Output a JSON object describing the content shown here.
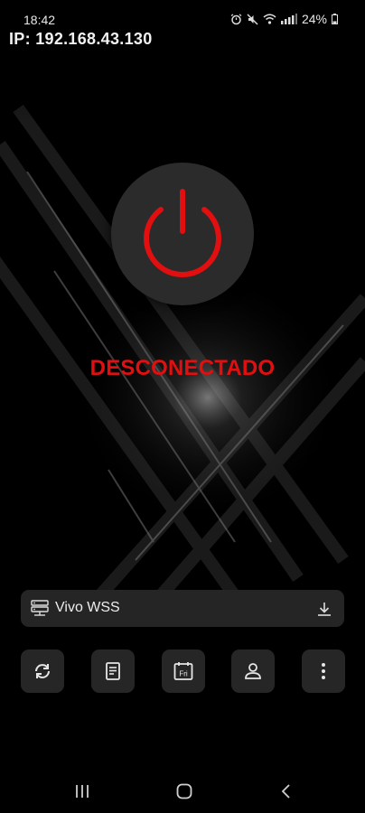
{
  "status_bar": {
    "time": "18:42",
    "battery": "24%",
    "icons": [
      "alarm-icon",
      "mute-icon",
      "wifi-icon",
      "signal-icon",
      "battery-icon"
    ]
  },
  "ip_label": "IP: 192.168.43.130",
  "connection": {
    "status": "DESCONECTADO",
    "status_color": "#e10f0f",
    "power_icon": "power-icon"
  },
  "server": {
    "name": "Vivo WSS",
    "icon": "server-icon",
    "action_icon": "download-icon"
  },
  "toolbar": {
    "buttons": [
      "refresh-icon",
      "document-icon",
      "calendar-icon",
      "user-icon",
      "more-vertical-icon"
    ],
    "calendar_label": "Fri"
  },
  "nav": {
    "buttons": [
      "recent-apps-icon",
      "home-icon",
      "back-icon"
    ]
  },
  "colors": {
    "background": "#000000",
    "accent": "#e10f0f",
    "panel": "#252525"
  }
}
